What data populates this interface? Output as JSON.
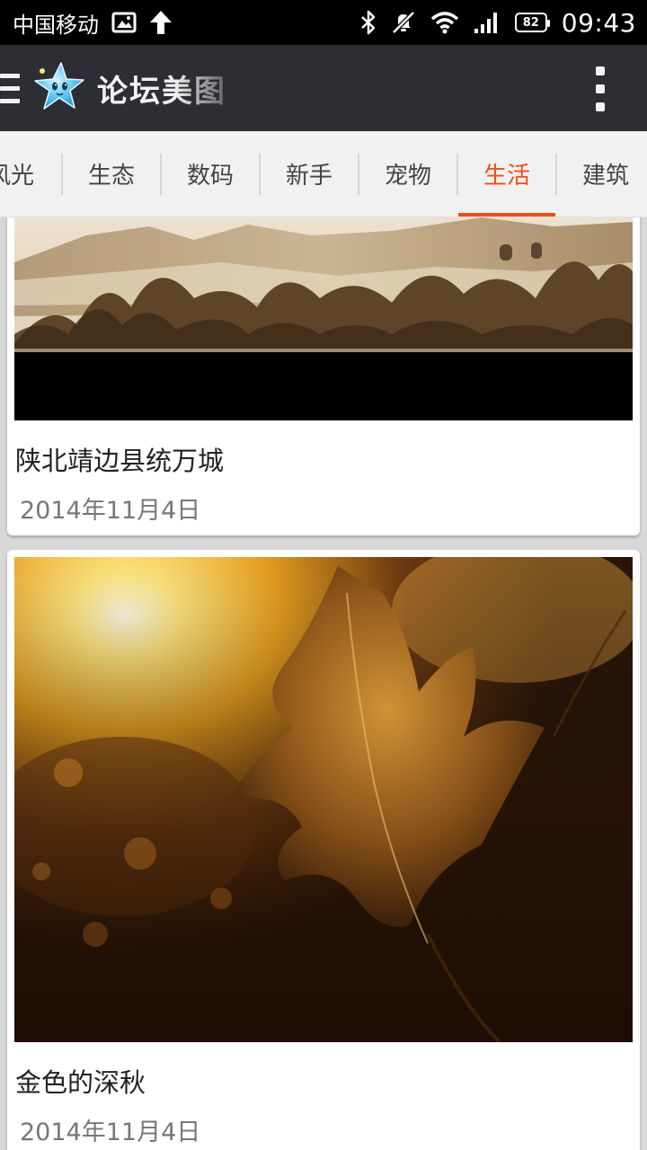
{
  "status_bar": {
    "carrier": "中国移动",
    "battery": "82",
    "time": "09:43",
    "icons": [
      "image-icon",
      "upload-arrow-icon",
      "bluetooth-icon",
      "mute-icon",
      "wifi-icon",
      "signal-icon",
      "battery-icon"
    ]
  },
  "app_bar": {
    "title": "论坛美图",
    "icons": [
      "menu-icon",
      "starfish-logo-icon",
      "overflow-menu-icon"
    ]
  },
  "tabs": [
    {
      "label": "风光",
      "active": false
    },
    {
      "label": "生态",
      "active": false
    },
    {
      "label": "数码",
      "active": false
    },
    {
      "label": "新手",
      "active": false
    },
    {
      "label": "宠物",
      "active": false
    },
    {
      "label": "生活",
      "active": true
    },
    {
      "label": "建筑",
      "active": false
    }
  ],
  "colors": {
    "accent": "#f04e14",
    "app_bar": "#2c2e33",
    "tab_bar": "#f1f1f1"
  },
  "feed": [
    {
      "title": "陕北靖边县统万城",
      "date": "2014年11月4日"
    },
    {
      "title": "金色的深秋",
      "date": "2014年11月4日"
    }
  ]
}
